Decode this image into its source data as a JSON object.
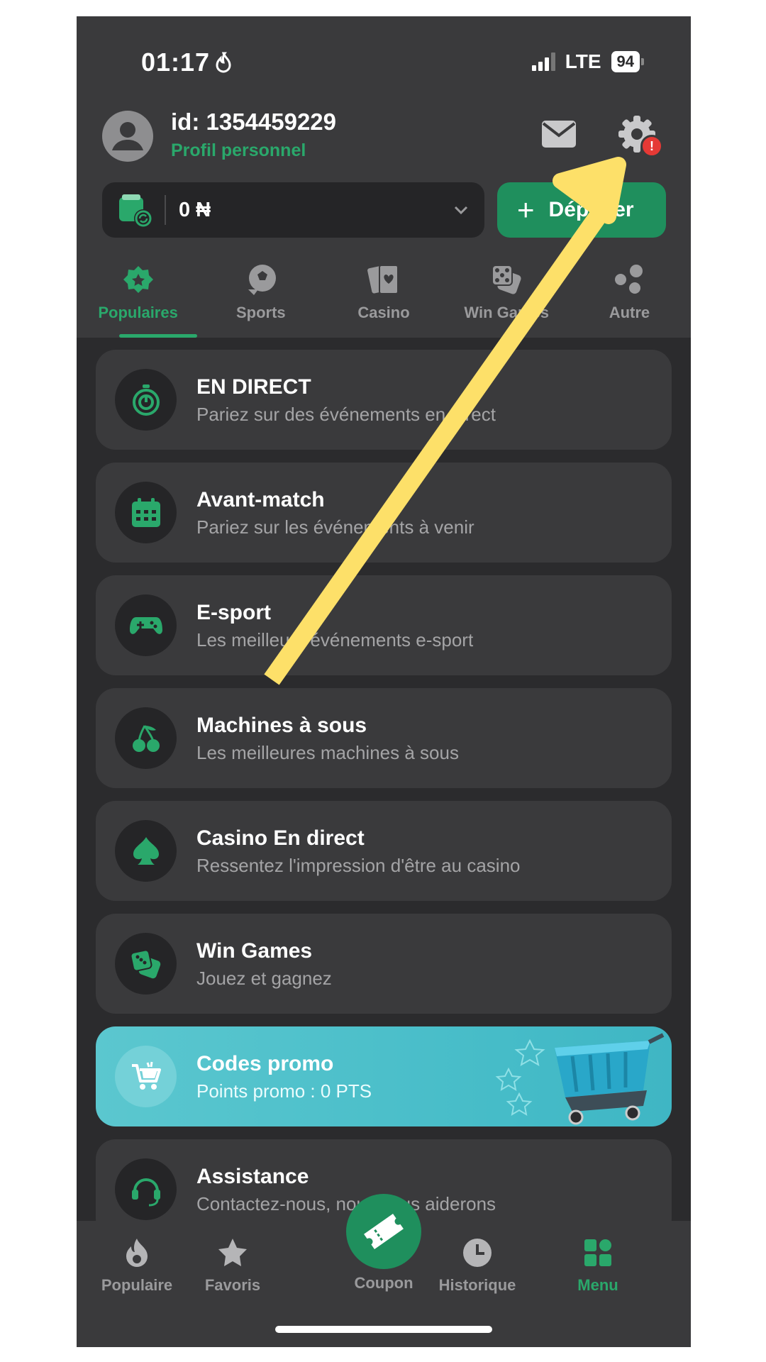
{
  "status_bar": {
    "time": "01:17",
    "network": "LTE",
    "battery": "94"
  },
  "header": {
    "user_id": "id: 1354459229",
    "profile_link": "Profil personnel",
    "balance": "0 ₦",
    "deposit_label": "Déposer"
  },
  "tabs": [
    {
      "label": "Populaires",
      "icon": "star-badge-icon",
      "active": true
    },
    {
      "label": "Sports",
      "icon": "soccer-ball-icon",
      "active": false
    },
    {
      "label": "Casino",
      "icon": "playing-cards-icon",
      "active": false
    },
    {
      "label": "Win Games",
      "icon": "dice-icon",
      "active": false
    },
    {
      "label": "Autre",
      "icon": "dots-icon",
      "active": false
    }
  ],
  "menu": [
    {
      "title": "EN DIRECT",
      "subtitle": "Pariez sur des événements en direct",
      "icon": "stopwatch-icon"
    },
    {
      "title": "Avant-match",
      "subtitle": "Pariez sur les événements à venir",
      "icon": "calendar-icon"
    },
    {
      "title": "E-sport",
      "subtitle": "Les meilleurs événements e-sport",
      "icon": "gamepad-icon"
    },
    {
      "title": "Machines à sous",
      "subtitle": "Les meilleures machines à sous",
      "icon": "cherries-icon"
    },
    {
      "title": "Casino En direct",
      "subtitle": "Ressentez l'impression d'être au casino",
      "icon": "spade-icon"
    },
    {
      "title": "Win Games",
      "subtitle": "Jouez et gagnez",
      "icon": "dice-icon"
    },
    {
      "title": "Codes promo",
      "subtitle": "Points promo : 0 PTS",
      "icon": "cart-icon"
    },
    {
      "title": "Assistance",
      "subtitle": "Contactez-nous, nous vous aiderons",
      "icon": "headset-icon"
    }
  ],
  "bottom_nav": [
    {
      "label": "Populaire",
      "icon": "flame-icon",
      "active": false
    },
    {
      "label": "Favoris",
      "icon": "star-icon",
      "active": false
    },
    {
      "label": "Coupon",
      "icon": "ticket-icon",
      "active": false
    },
    {
      "label": "Historique",
      "icon": "clock-icon",
      "active": false
    },
    {
      "label": "Menu",
      "icon": "grid-icon",
      "active": true
    }
  ],
  "colors": {
    "accent": "#2aa86b",
    "deposit": "#1f8f5d",
    "background": "#2b2b2d",
    "card": "#3a3a3c",
    "promo": "#4cc0ca",
    "annotation_arrow": "#fde069",
    "alert": "#e53935"
  }
}
